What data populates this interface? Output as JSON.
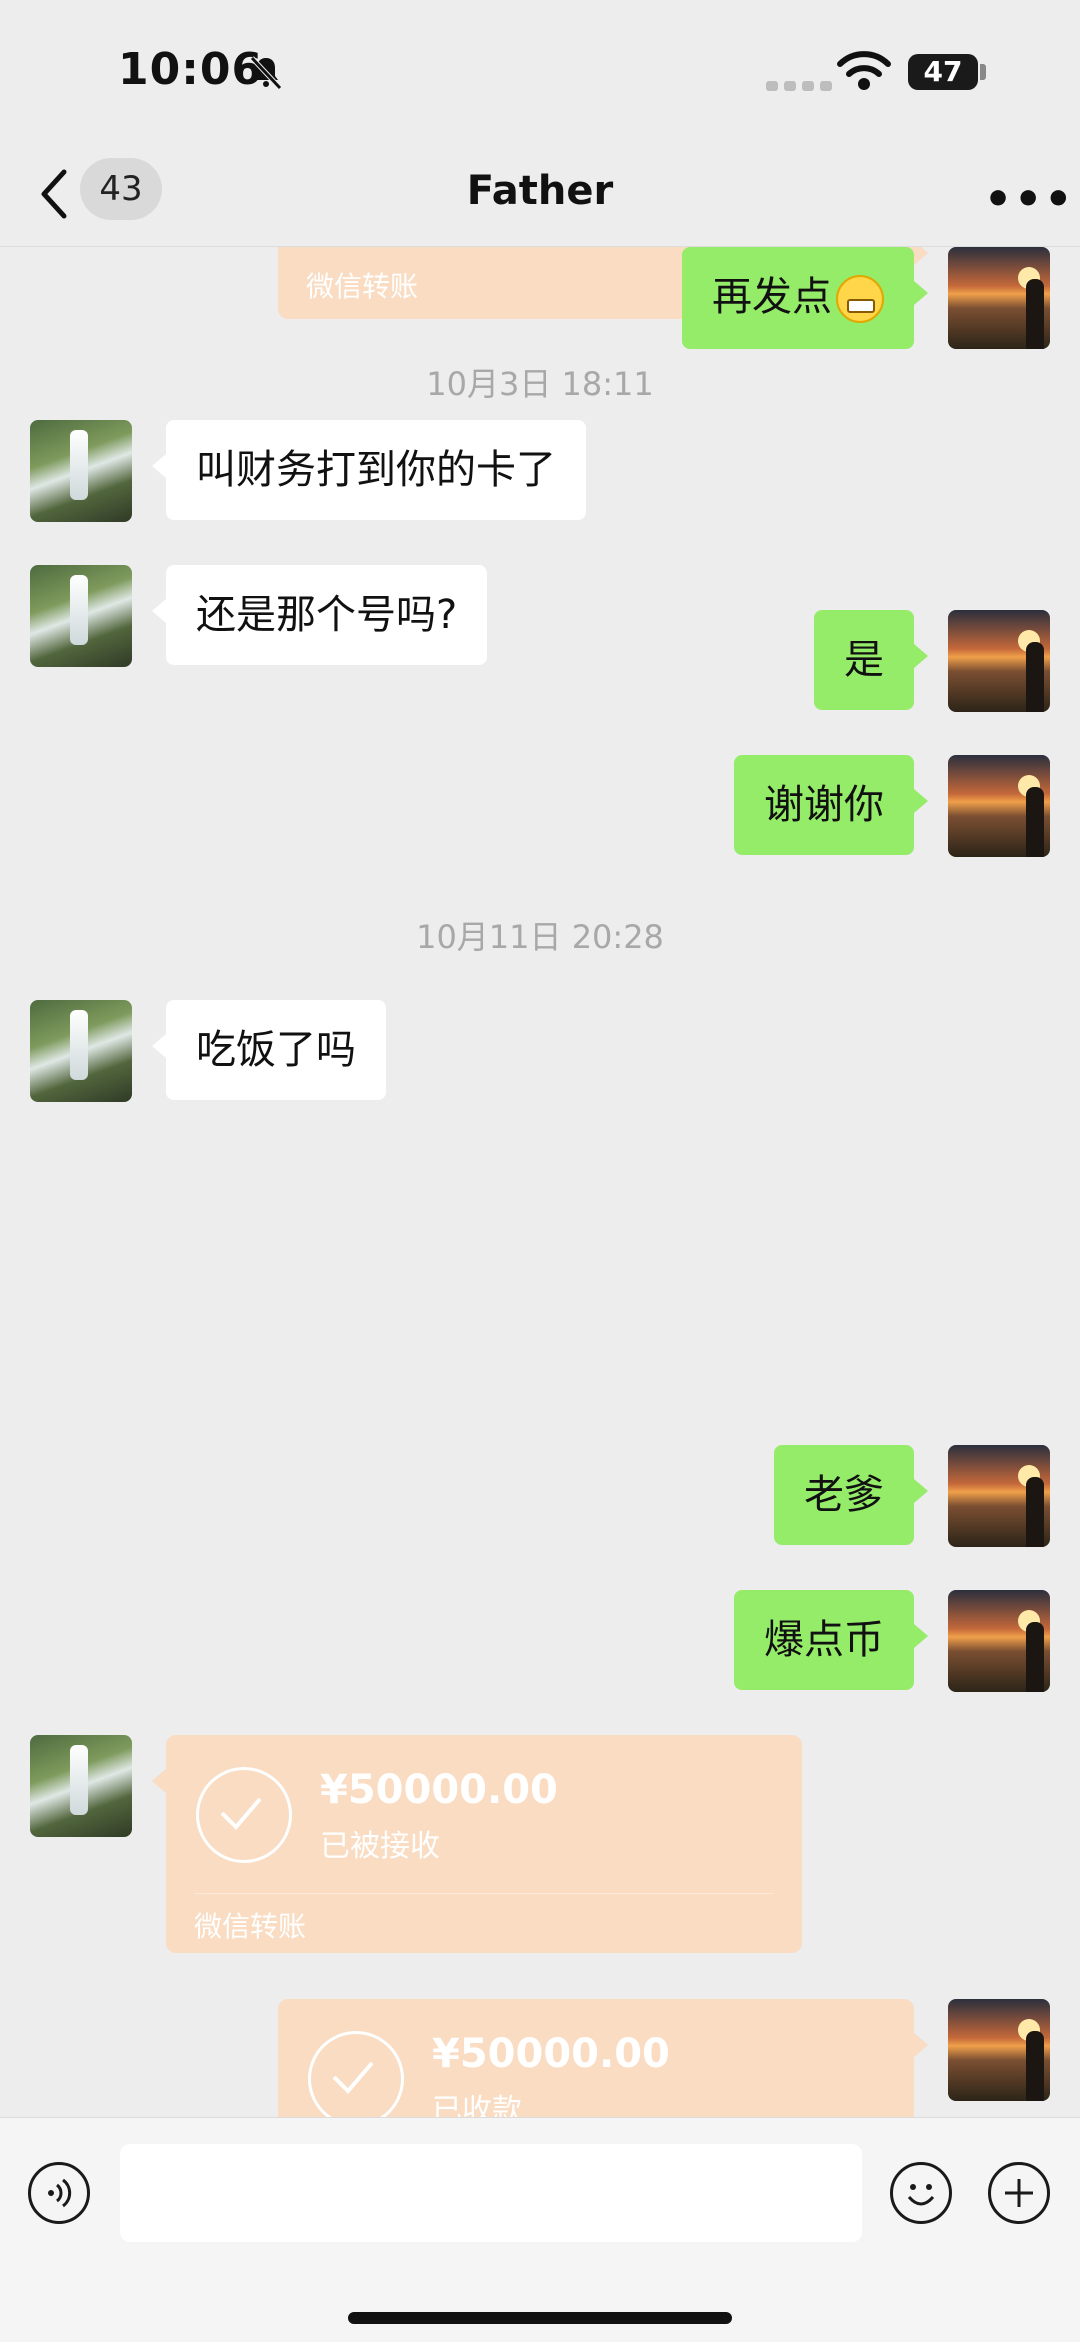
{
  "status": {
    "time": "10:06",
    "battery": "47"
  },
  "header": {
    "unread_count": "43",
    "title": "Father"
  },
  "messages": {
    "top_transfer_label": "微信转账",
    "m1": "再发点",
    "ts1": "10月3日 18:11",
    "m2": "叫财务打到你的卡了",
    "m3": "还是那个号吗?",
    "m4": "是",
    "m5": "谢谢你",
    "m6": "吃饭了吗",
    "ts2": "10月11日 20:28",
    "m7": "老爹",
    "m8": "爆点币",
    "transfer1": {
      "amount": "¥50000.00",
      "status": "已被接收",
      "label": "微信转账"
    },
    "transfer2": {
      "amount": "¥50000.00",
      "status": "已收款"
    }
  },
  "colors": {
    "self_bubble": "#95ec69",
    "other_bubble": "#ffffff",
    "transfer": "#f9dcc2",
    "background": "#ededed"
  }
}
